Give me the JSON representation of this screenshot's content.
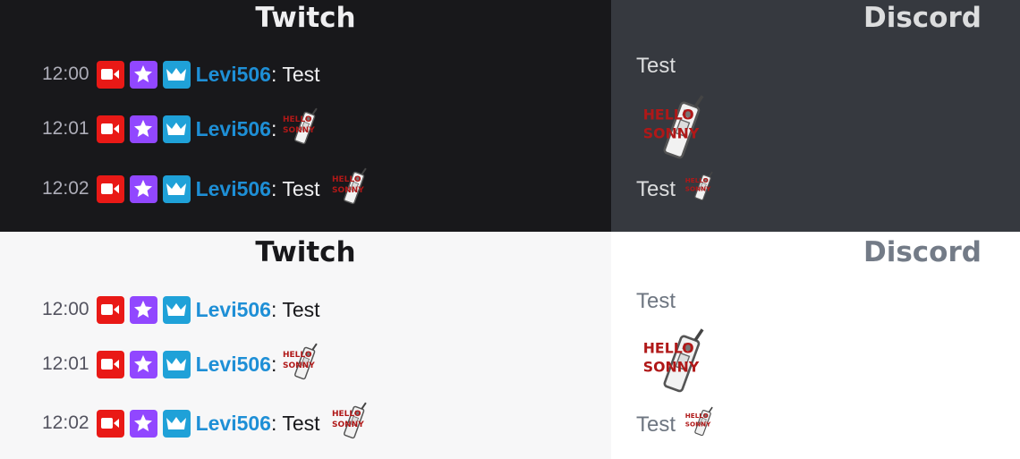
{
  "colors": {
    "twitch_dark_bg": "#18181b",
    "discord_dark_bg": "#36393f",
    "twitch_light_bg": "#f7f7f8",
    "discord_light_bg": "#ffffff",
    "username": "#1e8fd6",
    "badge_red": "#e91916",
    "badge_purple": "#9147ff",
    "badge_blue": "#1fa1d8"
  },
  "sections": {
    "twitch_title": "Twitch",
    "discord_title": "Discord"
  },
  "twitch_messages": [
    {
      "time": "12:00",
      "badges": [
        "camera-icon",
        "star-icon",
        "crown-icon"
      ],
      "user": "Levi506",
      "separator": ":",
      "text": "Test",
      "emote": null
    },
    {
      "time": "12:01",
      "badges": [
        "camera-icon",
        "star-icon",
        "crown-icon"
      ],
      "user": "Levi506",
      "separator": ":",
      "text": "",
      "emote": "hello-sonny-phone-emote"
    },
    {
      "time": "12:02",
      "badges": [
        "camera-icon",
        "star-icon",
        "crown-icon"
      ],
      "user": "Levi506",
      "separator": ":",
      "text": "Test",
      "emote": "hello-sonny-phone-emote"
    }
  ],
  "discord_messages": [
    {
      "text": "Test",
      "emote": null
    },
    {
      "text": "",
      "emote": "hello-sonny-phone-emote",
      "emote_size": "large"
    },
    {
      "text": "Test",
      "emote": "hello-sonny-phone-emote"
    }
  ],
  "emote_text": {
    "line1": "HELLO",
    "line2": "SONNY"
  }
}
